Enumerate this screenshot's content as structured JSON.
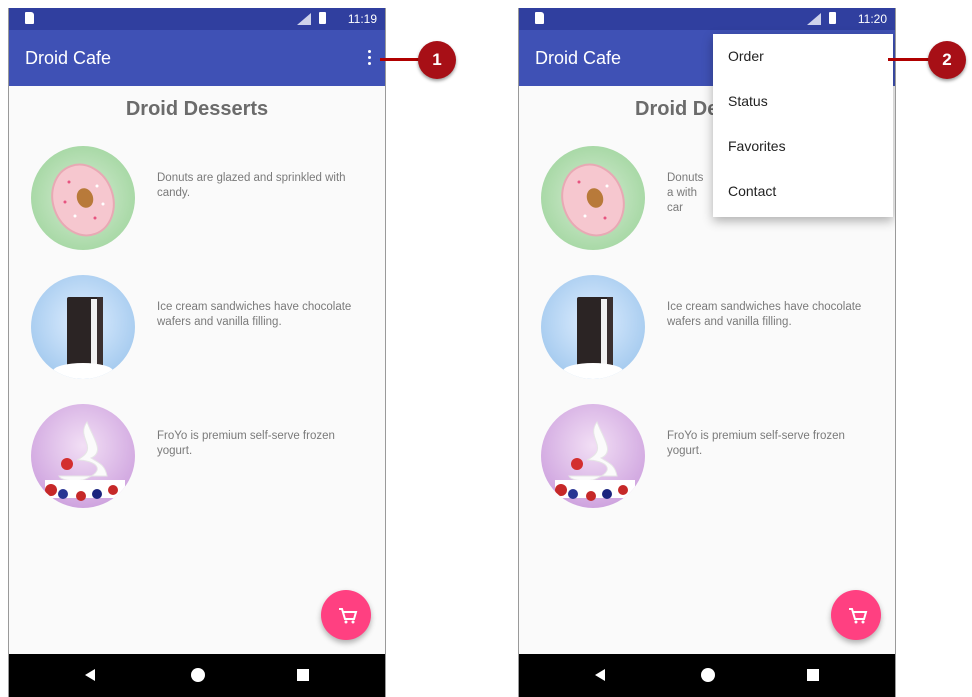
{
  "screens": [
    {
      "status_time": "11:19",
      "app_title": "Droid Cafe",
      "heading": "Droid Desserts",
      "items": [
        {
          "icon": "donut-image",
          "description": "Donuts are glazed and sprinkled with candy."
        },
        {
          "icon": "ice-cream-sandwich-image",
          "description": "Ice cream sandwiches have chocolate wafers and vanilla filling."
        },
        {
          "icon": "froyo-image",
          "description": "FroYo is premium self-serve frozen yogurt."
        }
      ]
    },
    {
      "status_time": "11:20",
      "app_title": "Droid Cafe",
      "heading": "Droid De",
      "items": [
        {
          "icon": "donut-image",
          "description": "Donuts a with car"
        },
        {
          "icon": "ice-cream-sandwich-image",
          "description": "Ice cream sandwiches have chocolate wafers and vanilla filling."
        },
        {
          "icon": "froyo-image",
          "description": "FroYo is premium self-serve frozen yogurt."
        }
      ],
      "menu": [
        "Order",
        "Status",
        "Favorites",
        "Contact"
      ]
    }
  ],
  "callouts": [
    "1",
    "2"
  ],
  "colors": {
    "status_bar": "#303f9f",
    "app_bar": "#3f51b5",
    "fab": "#ff4081",
    "callout": "#a70f16"
  }
}
